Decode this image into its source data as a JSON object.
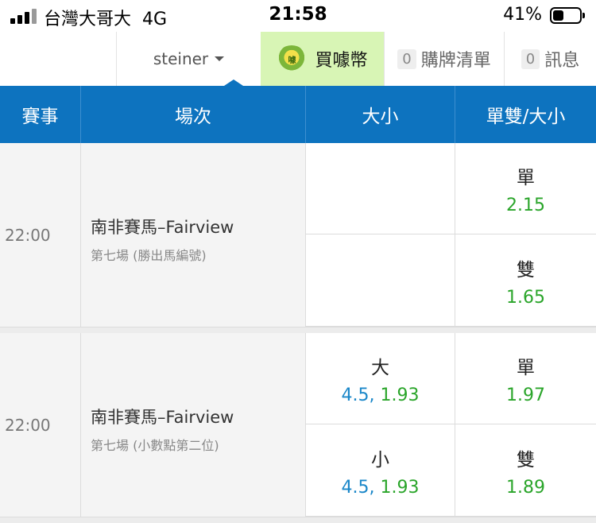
{
  "status_bar": {
    "carrier": "台灣大哥大",
    "network": "4G",
    "time": "21:58",
    "battery_percent": "41%",
    "battery_level": 0.41
  },
  "nav": {
    "user": "steiner",
    "coin_label": "買噱幣",
    "coin_icon_text": "噱",
    "list_count": "0",
    "list_label": "購牌清單",
    "msg_count": "0",
    "msg_label": "訊息"
  },
  "table": {
    "headers": [
      "賽事",
      "場次",
      "大小",
      "單雙/大小"
    ],
    "events": [
      {
        "time": "22:00",
        "match": "南非賽馬–Fairview",
        "sub": "第七場 (勝出馬編號)",
        "size_bets": [],
        "odd_even_bets": [
          {
            "label": "單",
            "odds": "2.15"
          },
          {
            "label": "雙",
            "odds": "1.65"
          }
        ]
      },
      {
        "time": "22:00",
        "match": "南非賽馬–Fairview",
        "sub": "第七場 (小數點第二位)",
        "size_bets": [
          {
            "label": "大",
            "line": "4.5,",
            "odds": "1.93"
          },
          {
            "label": "小",
            "line": "4.5,",
            "odds": "1.93"
          }
        ],
        "odd_even_bets": [
          {
            "label": "單",
            "odds": "1.97"
          },
          {
            "label": "雙",
            "odds": "1.89"
          }
        ]
      }
    ]
  },
  "colors": {
    "header_blue": "#0d73bf",
    "odds_green": "#2aa52a",
    "line_blue": "#1a87c9",
    "coin_tab_bg": "#d8f5b5"
  }
}
